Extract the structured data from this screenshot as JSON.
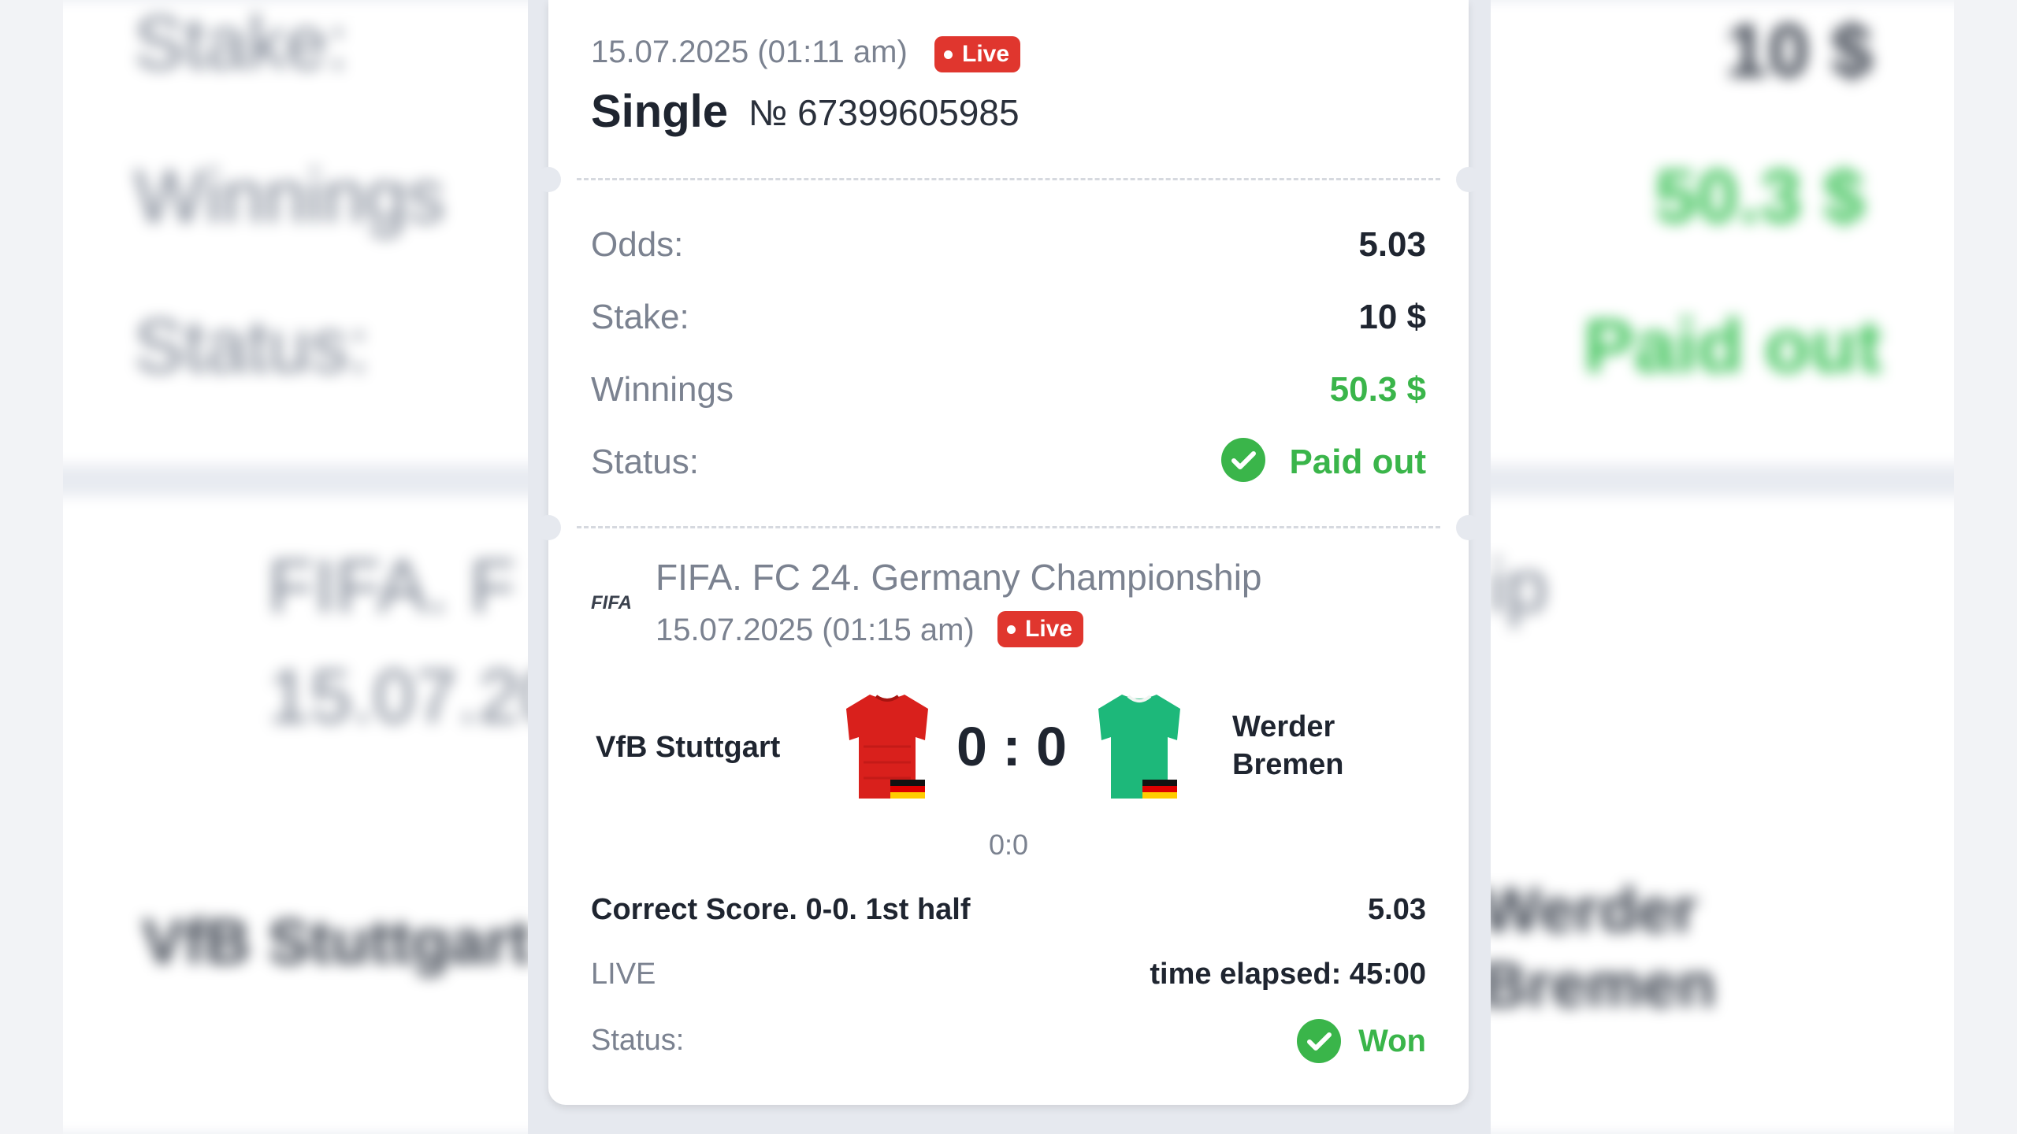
{
  "ticket": {
    "datetime": "15.07.2025 (01:11 am)",
    "live_badge": "Live",
    "type": "Single",
    "number": "№ 67399605985"
  },
  "summary": {
    "odds_label": "Odds:",
    "odds_value": "5.03",
    "stake_label": "Stake:",
    "stake_value": "10 $",
    "winnings_label": "Winnings",
    "winnings_value": "50.3 $",
    "status_label": "Status:",
    "status_value": "Paid out"
  },
  "event": {
    "logo_text": "FIFA",
    "league": "FIFA. FC 24. Germany Championship",
    "datetime": "15.07.2025 (01:15 am)",
    "live_badge": "Live",
    "home_team": "VfB Stuttgart",
    "away_team_line1": "Werder",
    "away_team_line2": "Bremen",
    "score": "0 : 0",
    "sub_score": "0:0",
    "home_shirt_color": "#d9201c",
    "away_shirt_color": "#1db87a",
    "bet_market": "Correct Score. 0-0. 1st half",
    "bet_odds": "5.03",
    "live_label": "LIVE",
    "time_elapsed": "time elapsed: 45:00",
    "status_label": "Status:",
    "status_value": "Won"
  },
  "colors": {
    "live_red": "#e0362e",
    "win_green": "#3ab54a"
  }
}
